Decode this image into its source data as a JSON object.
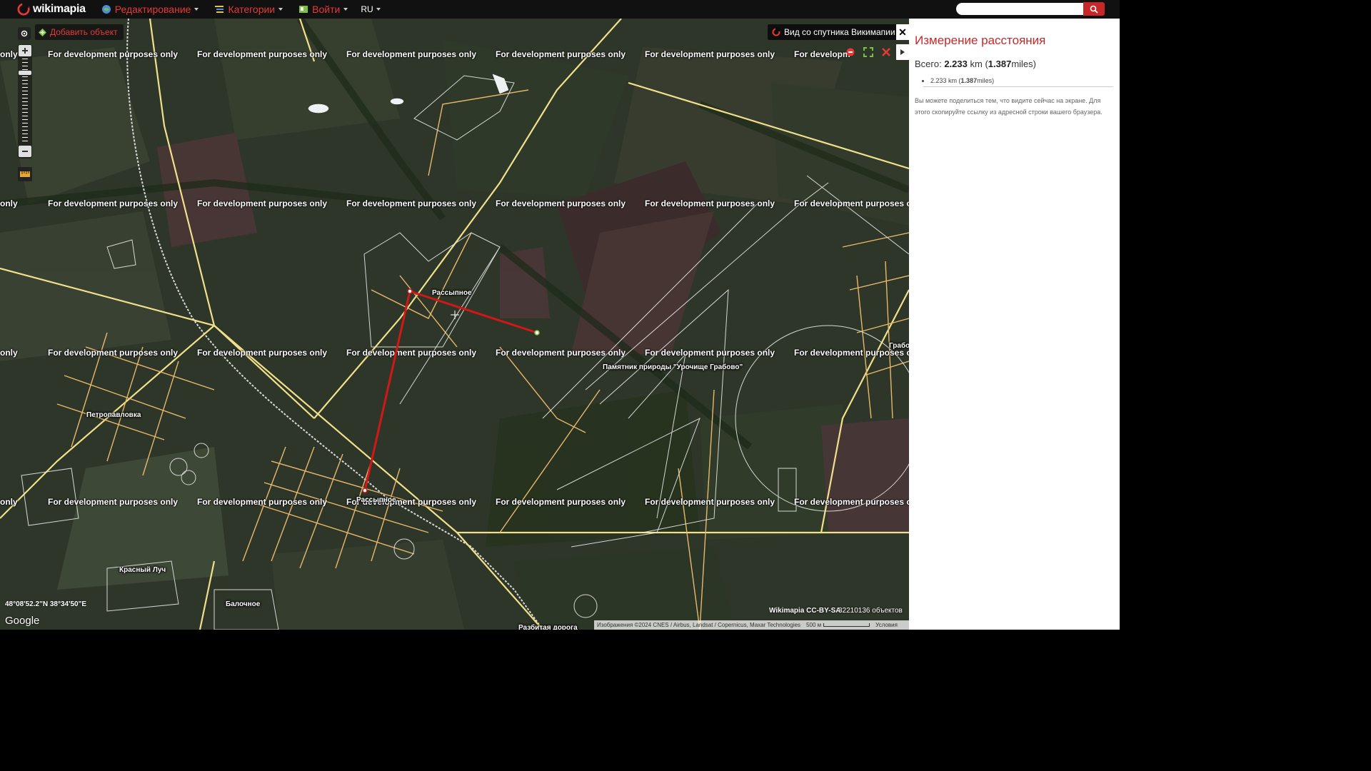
{
  "app": {
    "logo_text": "wikimapia"
  },
  "topbar": {
    "menus": [
      {
        "label": "Редактирование",
        "icon": "globe-pencil-icon"
      },
      {
        "label": "Категории",
        "icon": "category-list-icon"
      },
      {
        "label": "Войти",
        "icon": "login-card-icon"
      }
    ],
    "lang": "RU"
  },
  "map_controls": {
    "add_object_label": "Добавить объект",
    "satellite_label": "Вид со спутника Викимапии",
    "zoom_level_fraction": 0.15
  },
  "watermark": {
    "text": "For development purposes only",
    "edge_text": "only",
    "partial_text": "For developm"
  },
  "place_labels": [
    {
      "text": "Рассыпное"
    },
    {
      "text": "Памятник природы \"Урочище Грабово\""
    },
    {
      "text": "Петропавловка"
    },
    {
      "text": "Рассыпное"
    },
    {
      "text": "Красный Луч"
    },
    {
      "text": "Балочное"
    },
    {
      "text": "Грабо"
    },
    {
      "text": "Разбитая дорога"
    }
  ],
  "measure_path": {
    "units": "km",
    "total_km": 2.233
  },
  "footer": {
    "coords": "48°08'52.2\"N 38°34'50\"E",
    "google": "Google",
    "license": "Wikimapia CC-BY-SA",
    "objects": "32210136 объектов",
    "attribution": "Изображения ©2024 CNES / Airbus, Landsat / Copernicus, Maxar Technologies",
    "scale": "500 м",
    "terms": "Условия"
  },
  "panel": {
    "search_placeholder": "",
    "title": "Измерение расстояния",
    "total_prefix": "Всего:",
    "total_km": "2.233",
    "total_km_unit": "km (",
    "total_miles": "1.387",
    "total_miles_unit": "miles)",
    "segment": {
      "km": "2.233",
      "km_unit": "km (",
      "miles": "1.387",
      "miles_unit": "miles)"
    },
    "hint": "Вы можете поделиться тем, что видите сейчас на экране. Для этого скопируйте ссылку из адресной строки вашего браузера."
  },
  "colors": {
    "accent": "#e53935",
    "road_major": "#f0e08a",
    "road_minor": "#e8b86a",
    "measure_line": "#d01818"
  }
}
